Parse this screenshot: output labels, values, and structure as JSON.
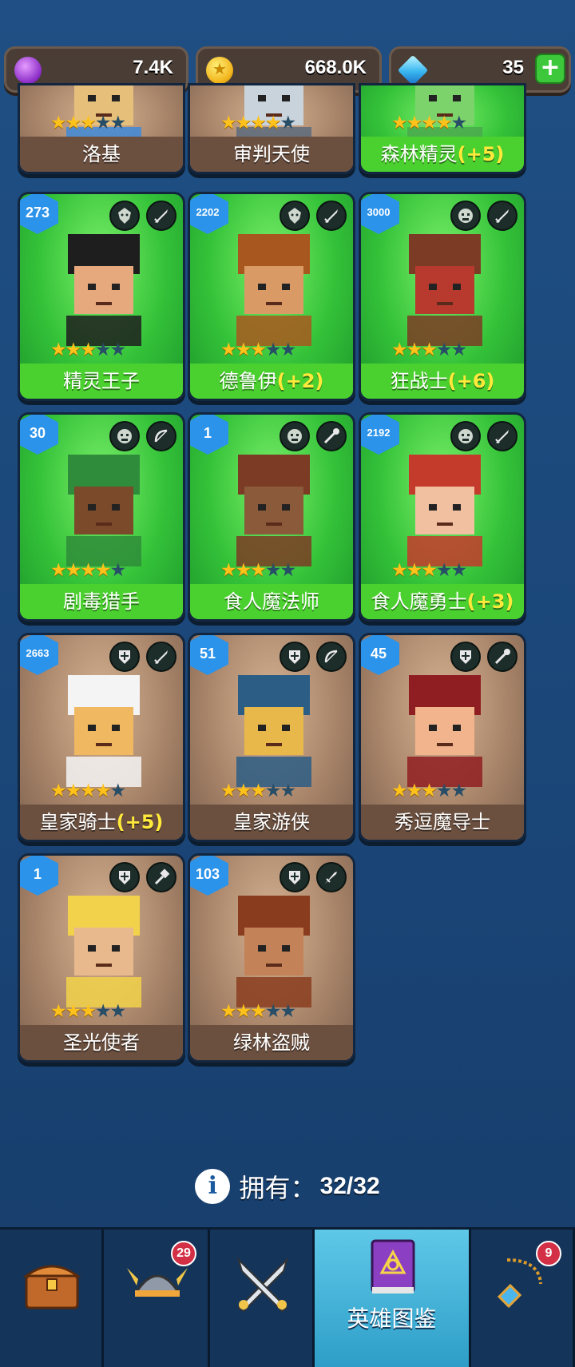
{
  "currency": {
    "gems": "7.4K",
    "gold": "668.0K",
    "diamonds": "35"
  },
  "heroes": [
    {
      "name": "洛基",
      "bonus": "",
      "stars": 3,
      "level": "",
      "bg": "brown",
      "partial": true
    },
    {
      "name": "审判天使",
      "bonus": "",
      "stars": 4,
      "level": "",
      "bg": "brown",
      "partial": true
    },
    {
      "name": "森林精灵",
      "bonus": "(+5)",
      "stars": 4,
      "level": "",
      "bg": "green",
      "partial": true
    },
    {
      "name": "精灵王子",
      "bonus": "",
      "stars": 3,
      "level": "273",
      "bg": "green",
      "race": "elf",
      "cls": "sword"
    },
    {
      "name": "德鲁伊",
      "bonus": "(+2)",
      "stars": 3,
      "level": "2202",
      "bg": "green",
      "race": "elf",
      "cls": "sword"
    },
    {
      "name": "狂战士",
      "bonus": "(+6)",
      "stars": 3,
      "level": "3000",
      "bg": "green",
      "race": "orc",
      "cls": "sword"
    },
    {
      "name": "剧毒猎手",
      "bonus": "",
      "stars": 4,
      "level": "30",
      "bg": "green",
      "race": "orc",
      "cls": "bow"
    },
    {
      "name": "食人魔法师",
      "bonus": "",
      "stars": 3,
      "level": "1",
      "bg": "green",
      "race": "orc",
      "cls": "staff"
    },
    {
      "name": "食人魔勇士",
      "bonus": "(+3)",
      "stars": 3,
      "level": "2192",
      "bg": "green",
      "race": "orc",
      "cls": "sword"
    },
    {
      "name": "皇家骑士",
      "bonus": "(+5)",
      "stars": 4,
      "level": "2663",
      "bg": "brown",
      "race": "human",
      "cls": "sword"
    },
    {
      "name": "皇家游侠",
      "bonus": "",
      "stars": 3,
      "level": "51",
      "bg": "brown",
      "race": "human",
      "cls": "bow"
    },
    {
      "name": "秀逗魔导士",
      "bonus": "",
      "stars": 3,
      "level": "45",
      "bg": "brown",
      "race": "human",
      "cls": "staff"
    },
    {
      "name": "圣光使者",
      "bonus": "",
      "stars": 3,
      "level": "1",
      "bg": "brown",
      "race": "human",
      "cls": "hammer"
    },
    {
      "name": "绿林盗贼",
      "bonus": "",
      "stars": 3,
      "level": "103",
      "bg": "brown",
      "race": "human",
      "cls": "dagger"
    }
  ],
  "owned": {
    "label": "拥有：",
    "count": "32/32"
  },
  "nav": [
    {
      "id": "chest",
      "label": "",
      "badge": "",
      "icon": "treasure-chest-icon"
    },
    {
      "id": "heroes",
      "label": "",
      "badge": "29",
      "icon": "viking-helmet-icon"
    },
    {
      "id": "battle",
      "label": "",
      "badge": "",
      "icon": "crossed-swords-icon"
    },
    {
      "id": "codex",
      "label": "英雄图鉴",
      "badge": "",
      "icon": "spell-book-icon"
    },
    {
      "id": "items",
      "label": "",
      "badge": "9",
      "icon": "amulet-icon"
    }
  ]
}
